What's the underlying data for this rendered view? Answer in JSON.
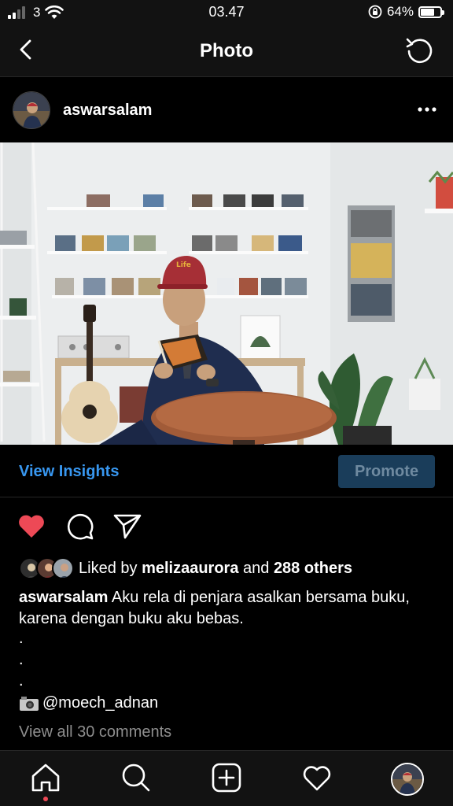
{
  "status_bar": {
    "carrier": "3",
    "time": "03.47",
    "battery_pct": "64%",
    "battery_level": 0.64
  },
  "nav": {
    "title": "Photo"
  },
  "post": {
    "username": "aswarsalam",
    "insights_label": "View Insights",
    "promote_label": "Promote",
    "liked_by_prefix": "Liked by ",
    "liked_by_user": "melizaaurora",
    "liked_by_middle": " and ",
    "liked_by_count": "288 others",
    "caption_user": "aswarsalam",
    "caption_text": "Aku rela di penjara asalkan bersama buku, karena dengan buku aku bebas.",
    "dot": ".",
    "credit_handle": "@moech_adnan",
    "view_comments": "View all 30 comments",
    "liked": true
  },
  "colors": {
    "accent": "#3897f0",
    "like": "#ed4956",
    "promote_bg": "#1a3d5a"
  },
  "icons": {
    "back": "chevron-left-icon",
    "refresh": "refresh-icon",
    "more": "more-horizontal-icon",
    "like": "heart-filled-icon",
    "comment": "comment-icon",
    "share": "send-icon",
    "credit": "camera-icon",
    "tabs": [
      "home-icon",
      "search-icon",
      "add-post-icon",
      "activity-heart-icon",
      "profile-avatar"
    ]
  }
}
